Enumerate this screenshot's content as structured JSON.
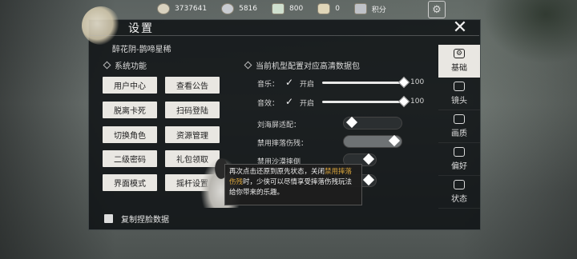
{
  "currencies": [
    {
      "icon": "coin-icon",
      "value": "3737641"
    },
    {
      "icon": "silver-icon",
      "value": "5816"
    },
    {
      "icon": "jade-icon",
      "value": "800"
    },
    {
      "icon": "tael-icon",
      "value": "0"
    },
    {
      "icon": "score-icon",
      "value": "积分"
    }
  ],
  "panel": {
    "title": "设置",
    "character_name": "醉花阴-鹊啼星稀"
  },
  "system": {
    "label": "系统功能",
    "buttons": [
      "用户中心",
      "查看公告",
      "脱离卡死",
      "扫码登陆",
      "切换角色",
      "资源管理",
      "二级密码",
      "礼包领取",
      "界面模式",
      "摇杆设置"
    ]
  },
  "right": {
    "hd_pack_label": "当前机型配置对应高清数据包",
    "music_label": "音乐：",
    "music_enabled_label": "开启",
    "music_value": "100",
    "sfx_label": "音效：",
    "sfx_enabled_label": "开启",
    "sfx_value": "100",
    "notch_label": "刘海屏适配：",
    "fall_damage_label": "禁用摔落伤残：",
    "sand_fall_label": "禁用沙漠摔倒"
  },
  "tooltip": {
    "part1": "再次点击还原到原先状态，关闭",
    "highlight": "禁用摔落伤残",
    "part2": "时，少侠可以尽情享受摔落伤残玩法给你带来的乐趣。"
  },
  "copy_face_label": "复制捏脸数据",
  "tabs": [
    {
      "label": "基础",
      "icon": "gear-icon",
      "active": true
    },
    {
      "label": "镜头",
      "icon": "camera-icon",
      "active": false
    },
    {
      "label": "画质",
      "icon": "monitor-icon",
      "active": false
    },
    {
      "label": "偏好",
      "icon": "user-pref-icon",
      "active": false
    },
    {
      "label": "状态",
      "icon": "status-icon",
      "active": false
    }
  ],
  "colors": {
    "highlight": "#d8a43c",
    "panel_bg": "#0e1214",
    "button_bg": "#e9e7e2"
  }
}
